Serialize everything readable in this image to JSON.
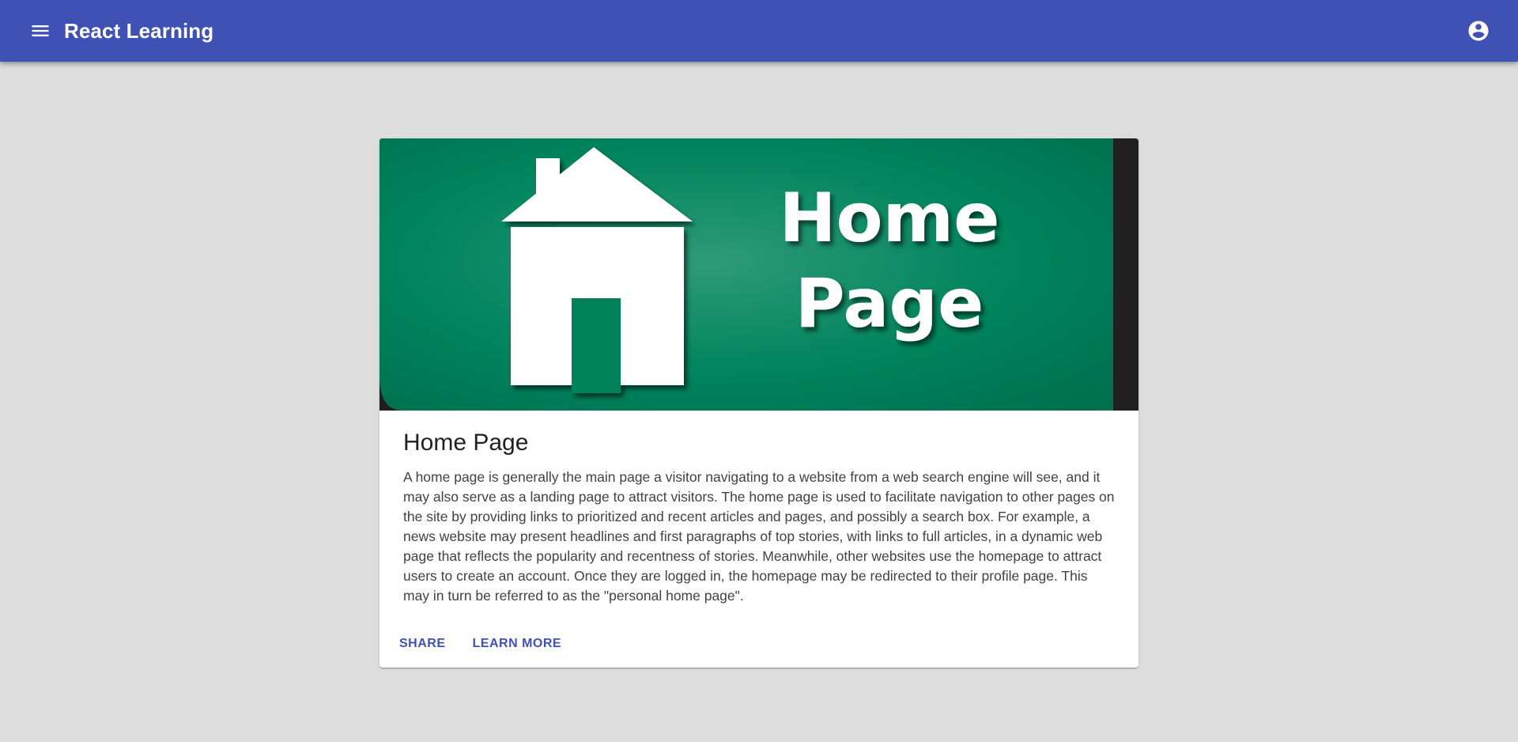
{
  "appbar": {
    "title": "React Learning",
    "menu_icon": "menu-icon",
    "account_icon": "account-circle-icon",
    "color": "#3f51b5"
  },
  "card": {
    "image": {
      "line1": "Home",
      "line2": "Page",
      "bg_color": "#00875f"
    },
    "title": "Home Page",
    "body": "A home page is generally the main page a visitor navigating to a website from a web search engine will see, and it may also serve as a landing page to attract visitors. The home page is used to facilitate navigation to other pages on the site by providing links to prioritized and recent articles and pages, and possibly a search box. For example, a news website may present headlines and first paragraphs of top stories, with links to full articles, in a dynamic web page that reflects the popularity and recentness of stories. Meanwhile, other websites use the homepage to attract users to create an account. Once they are logged in, the homepage may be redirected to their profile page. This may in turn be referred to as the \"personal home page\".",
    "actions": {
      "share": "SHARE",
      "learn_more": "LEARN MORE"
    }
  }
}
